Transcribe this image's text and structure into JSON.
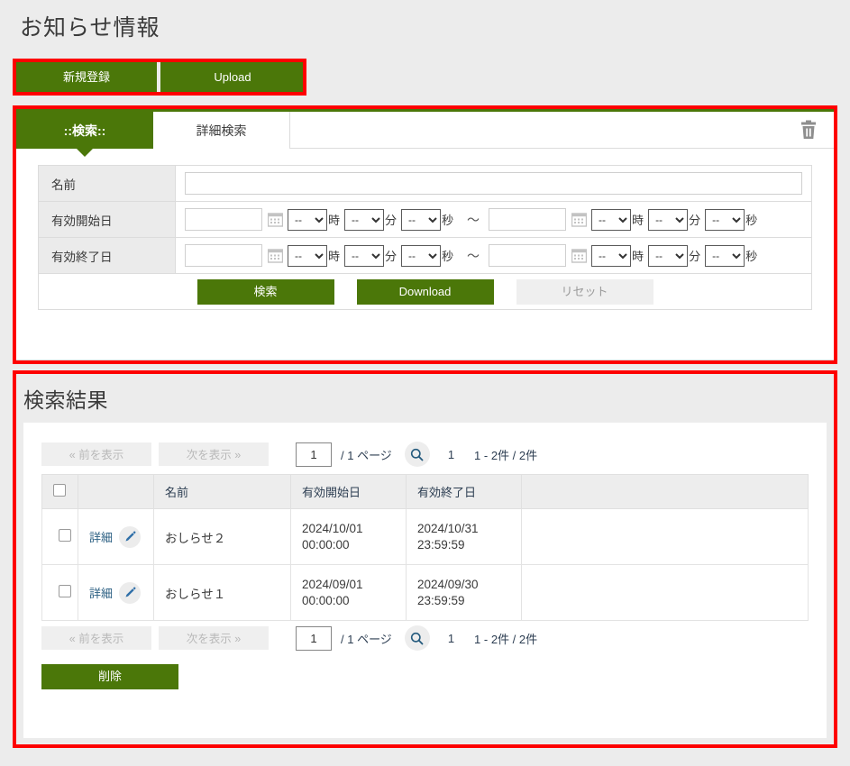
{
  "page": {
    "title": "お知らせ情報"
  },
  "toolbar": {
    "new_label": "新規登録",
    "upload_label": "Upload"
  },
  "search_panel": {
    "tabs": [
      {
        "label": "::検索::",
        "active": true
      },
      {
        "label": "詳細検索",
        "active": false
      }
    ],
    "trash_icon": "trash-icon",
    "fields": [
      {
        "label": "名前",
        "type": "text",
        "value": "",
        "placeholder": ""
      },
      {
        "label": "有効開始日",
        "type": "datetime-range",
        "from": {
          "date": "",
          "hour": "--",
          "minute": "--",
          "second": "--"
        },
        "to": {
          "date": "",
          "hour": "--",
          "minute": "--",
          "second": "--"
        }
      },
      {
        "label": "有効終了日",
        "type": "datetime-range",
        "from": {
          "date": "",
          "hour": "--",
          "minute": "--",
          "second": "--"
        },
        "to": {
          "date": "",
          "hour": "--",
          "minute": "--",
          "second": "--"
        }
      }
    ],
    "units": {
      "hour": "時",
      "minute": "分",
      "second": "秒",
      "range_separator": "〜"
    },
    "time_options": [
      "--"
    ],
    "actions": {
      "search_label": "検索",
      "download_label": "Download",
      "reset_label": "リセット"
    }
  },
  "result_section": {
    "title": "検索結果",
    "pager": {
      "prev_label": "« 前を表示",
      "next_label": "次を表示 »",
      "page_value": "1",
      "page_total_label": "/ 1 ページ",
      "search_icon": "search-icon",
      "current_page_number": "1",
      "count_label": "1 - 2件 / 2件"
    },
    "table": {
      "headers": {
        "select_all": "",
        "detail": "",
        "name": "名前",
        "start": "有効開始日",
        "end": "有効終了日",
        "extra": ""
      },
      "rows": [
        {
          "detail_label": "詳細",
          "edit_icon": "pencil-icon",
          "name": "おしらせ２",
          "start_date": "2024/10/01",
          "start_time": "00:00:00",
          "end_date": "2024/10/31",
          "end_time": "23:59:59"
        },
        {
          "detail_label": "詳細",
          "edit_icon": "pencil-icon",
          "name": "おしらせ１",
          "start_date": "2024/09/01",
          "start_time": "00:00:00",
          "end_date": "2024/09/30",
          "end_time": "23:59:59"
        }
      ]
    },
    "delete_label": "削除"
  },
  "colors": {
    "accent_green": "#4b7709",
    "annotation_red": "#fe0000",
    "page_background": "#ececec",
    "link_blue": "#2b5f82"
  }
}
